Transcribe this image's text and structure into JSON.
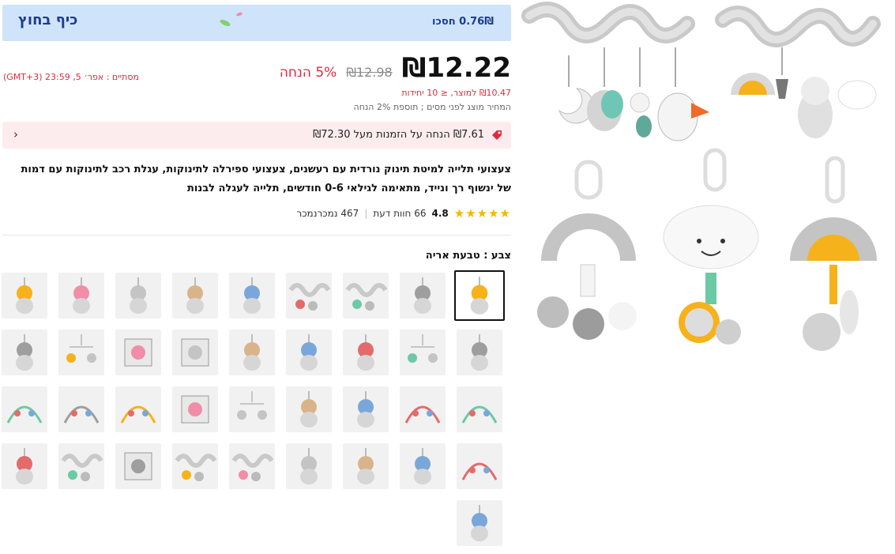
{
  "banner": {
    "title": "כיף בחוץ",
    "save": "0.76₪ חסכו"
  },
  "price": {
    "current": "₪12.22",
    "original": "₪12.98",
    "discount": "5% הנחה",
    "ends": "(GMT+3) 23:59 ,5 מסתיים : אפר׳",
    "unit": "₪10.47 למוצר, ≤ 10 יחידות",
    "tax_note": "המחיר מוצג לפני מסים ; תוספת 2% הנחה"
  },
  "coupon": {
    "text": "₪7.61 הנחה על הזמנות מעל ₪72.30"
  },
  "product": {
    "title": "צעצועי תלייה למיטת תינוק נורדית עם רעשנים, צעצועי ספירלה לתינוקות, עגלת רכב לתינוקות עם דמות של ינשוף רך ונייד, מתאימה לגילאי 0-6 חודשים, תלייה לעגלה לבנות"
  },
  "rating": {
    "stars": "★★★★★",
    "value": "4.8",
    "reviews": "66 חוות דעת",
    "sold": "467 נמכרנמכר"
  },
  "color": {
    "label": "צבע : טבעת אריה"
  },
  "swatches": [
    {
      "kind": "lion-ring",
      "selected": true
    },
    {
      "kind": "plush-set",
      "selected": false
    },
    {
      "kind": "spiral",
      "selected": false
    },
    {
      "kind": "spiral",
      "selected": false
    },
    {
      "kind": "star",
      "selected": false
    },
    {
      "kind": "bunny",
      "selected": false
    },
    {
      "kind": "cloud",
      "selected": false
    },
    {
      "kind": "rainbow",
      "selected": false
    },
    {
      "kind": "plush",
      "selected": false
    },
    {
      "kind": "fish",
      "selected": false
    },
    {
      "kind": "rainbow-mobile",
      "selected": false
    },
    {
      "kind": "bear",
      "selected": false
    },
    {
      "kind": "bear-ring",
      "selected": false
    },
    {
      "kind": "giraffe",
      "selected": false
    },
    {
      "kind": "book",
      "selected": false
    },
    {
      "kind": "bunny-book",
      "selected": false
    },
    {
      "kind": "mobile-set",
      "selected": false
    },
    {
      "kind": "owl-set",
      "selected": false
    },
    {
      "kind": "arch",
      "selected": false
    },
    {
      "kind": "arch",
      "selected": false
    },
    {
      "kind": "lion",
      "selected": false
    },
    {
      "kind": "lion",
      "selected": false
    },
    {
      "kind": "mobile-hang",
      "selected": false
    },
    {
      "kind": "mirror",
      "selected": false
    },
    {
      "kind": "crib-mobile",
      "selected": false
    },
    {
      "kind": "crib-mobile",
      "selected": false
    },
    {
      "kind": "crib",
      "selected": false
    },
    {
      "kind": "crib-mobile",
      "selected": false
    },
    {
      "kind": "elephant",
      "selected": false
    },
    {
      "kind": "lion-ball",
      "selected": false
    },
    {
      "kind": "bunny-ring",
      "selected": false
    },
    {
      "kind": "spiral",
      "selected": false
    },
    {
      "kind": "spiral",
      "selected": false
    },
    {
      "kind": "book-set",
      "selected": false
    },
    {
      "kind": "spiral",
      "selected": false
    },
    {
      "kind": "girl-doll",
      "selected": false
    },
    {
      "kind": "pig-doll",
      "selected": false
    }
  ],
  "colors": {
    "banner_bg": "#cfe4fb",
    "accent_red": "#e02a3f",
    "brand_blue": "#1b3d8f",
    "star": "#f7b500"
  }
}
